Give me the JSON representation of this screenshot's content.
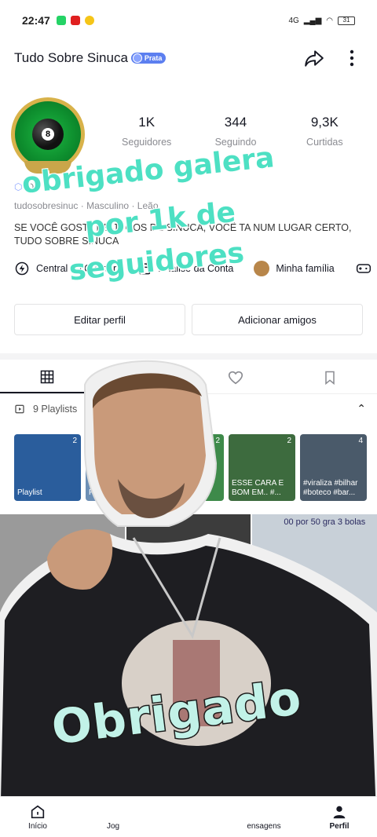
{
  "status_bar": {
    "time": "22:47",
    "network": "4G",
    "battery": "31"
  },
  "header": {
    "title": "Tudo Sobre Sinuca",
    "badge": "Prata"
  },
  "stats": [
    {
      "value": "1K",
      "label": "Seguidores"
    },
    {
      "value": "344",
      "label": "Seguindo"
    },
    {
      "value": "9,3K",
      "label": "Curtidas"
    }
  ],
  "bio": {
    "meta_1": "D",
    "username": "tudosobresinuc",
    "gender": "Masculino",
    "sign": "Leão",
    "text": "SE VOCÊ GOSTA DE JOGOS DE SINUCA, VOCÊ TA NUM LUGAR CERTO, TUDO SOBRE SINUCA"
  },
  "shortcuts": [
    {
      "label": "Central do Criador",
      "icon": "lightning-icon"
    },
    {
      "label": "Análise da Conta",
      "icon": "calendar-icon"
    },
    {
      "label": "Minha família",
      "icon": "family-avatar"
    }
  ],
  "buttons": {
    "edit_profile": "Editar perfil",
    "add_friends": "Adicionar amigos"
  },
  "playlists": {
    "header": "9 Playlists",
    "items": [
      {
        "label": "Playlist",
        "count": "2",
        "color": "#2a5d9c"
      },
      {
        "label": "Playl",
        "count": "",
        "color": "#6d8fb5"
      },
      {
        "label": "bilhar ry...",
        "count": "2",
        "color": "#3e8a4a"
      },
      {
        "label": "ESSE CARA E BOM EM.. #...",
        "count": "2",
        "color": "#3d6b3e"
      },
      {
        "label": "#viraliza #bilhar #boteco #bar...",
        "count": "4",
        "color": "#4a5a6a"
      }
    ]
  },
  "grid": {
    "cell_text": "Ca",
    "overlay_caption": "00 por 50 gra 3 bolas"
  },
  "overlay": {
    "line1": "obrigado galera",
    "line2": "por 1k de",
    "line3": "seguidores",
    "big": "Obrigado"
  },
  "bottom_nav": [
    {
      "label": "Início",
      "active": false
    },
    {
      "label": "Jog",
      "active": false
    },
    {
      "label": "",
      "active": false
    },
    {
      "label": "ensagens",
      "active": false
    },
    {
      "label": "Perfil",
      "active": true
    }
  ]
}
